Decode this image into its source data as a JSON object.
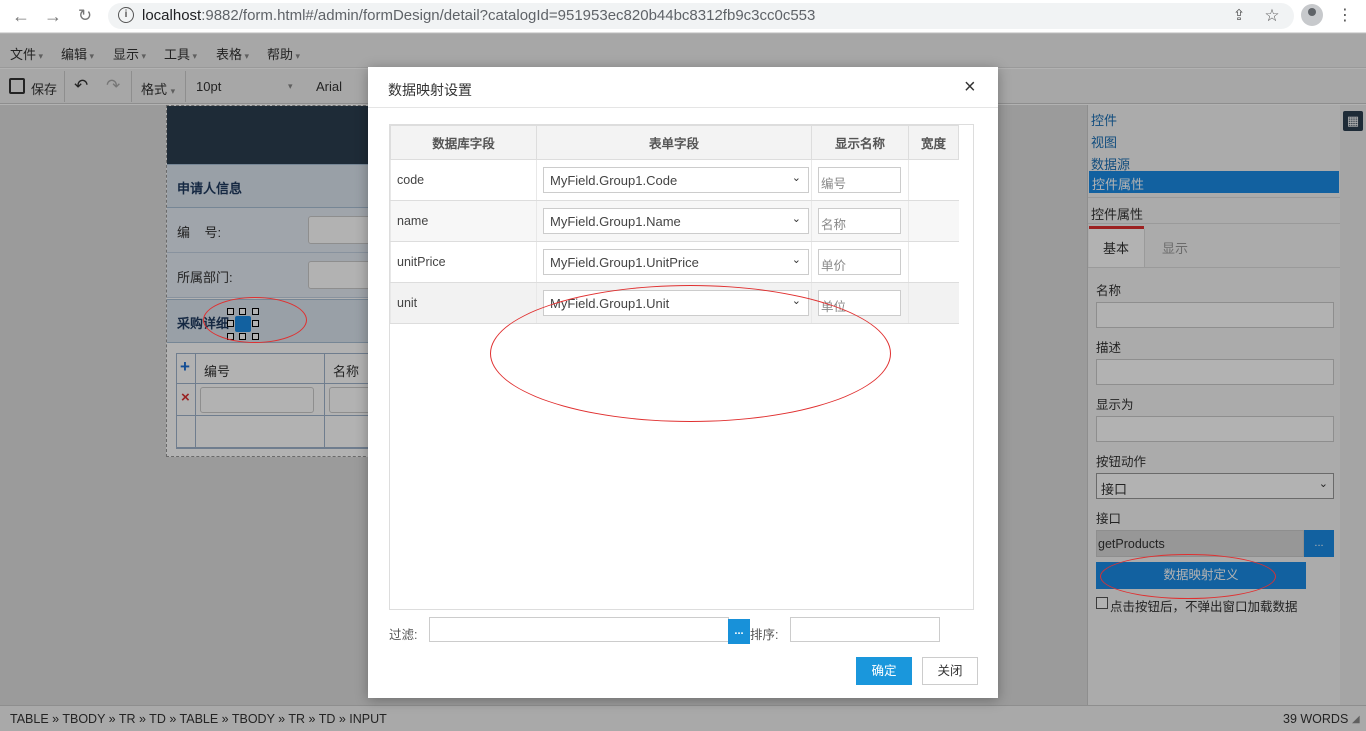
{
  "browser": {
    "url_host": "localhost",
    "url_rest": ":9882/form.html#/admin/formDesign/detail?catalogId=951953ec820b44bc8312fb9c3cc0c553"
  },
  "menubar": [
    "文件",
    "编辑",
    "显示",
    "工具",
    "表格",
    "帮助"
  ],
  "toolbar": {
    "save_label": "保存",
    "format_label": "格式",
    "font_size": "10pt",
    "font_family": "Arial"
  },
  "form": {
    "section1": "申请人信息",
    "field_no": "编    号:",
    "field_dept": "所属部门:",
    "section2": "采购详细",
    "grid_col1": "编号",
    "grid_col2": "名称",
    "add_icon": "+",
    "del_icon": "×"
  },
  "right_panel": {
    "links": [
      "控件",
      "视图",
      "数据源"
    ],
    "active": "控件属性",
    "section_title": "控件属性",
    "tabs": [
      "基本",
      "显示"
    ],
    "label_name": "名称",
    "label_desc": "描述",
    "label_display": "显示为",
    "label_action": "按钮动作",
    "action_value": "接口",
    "label_api": "接口",
    "api_value": "getProducts",
    "api_btn": "...",
    "mapping_btn": "数据映射定义",
    "checkbox_label": "点击按钮后，不弹出窗口加载数据"
  },
  "status": {
    "path": "TABLE » TBODY » TR » TD » TABLE » TBODY » TR » TD » INPUT",
    "words": "39 WORDS"
  },
  "dialog": {
    "title": "数据映射设置",
    "close": "×",
    "headers": [
      "数据库字段",
      "表单字段",
      "显示名称",
      "宽度"
    ],
    "rows": [
      {
        "db": "code",
        "field": "MyField.Group1.Code",
        "display": "编号"
      },
      {
        "db": "name",
        "field": "MyField.Group1.Name",
        "display": "名称"
      },
      {
        "db": "unitPrice",
        "field": "MyField.Group1.UnitPrice",
        "display": "单价"
      },
      {
        "db": "unit",
        "field": "MyField.Group1.Unit",
        "display": "单位"
      }
    ],
    "filter_label": "过滤:",
    "sort_label": "排序:",
    "dots": "...",
    "ok": "确定",
    "cancel": "关闭"
  },
  "colors": {
    "accent": "#1a97dc",
    "active_item": "#1a8be6",
    "annotation": "#e03030",
    "header_dark": "#2c3e50"
  }
}
